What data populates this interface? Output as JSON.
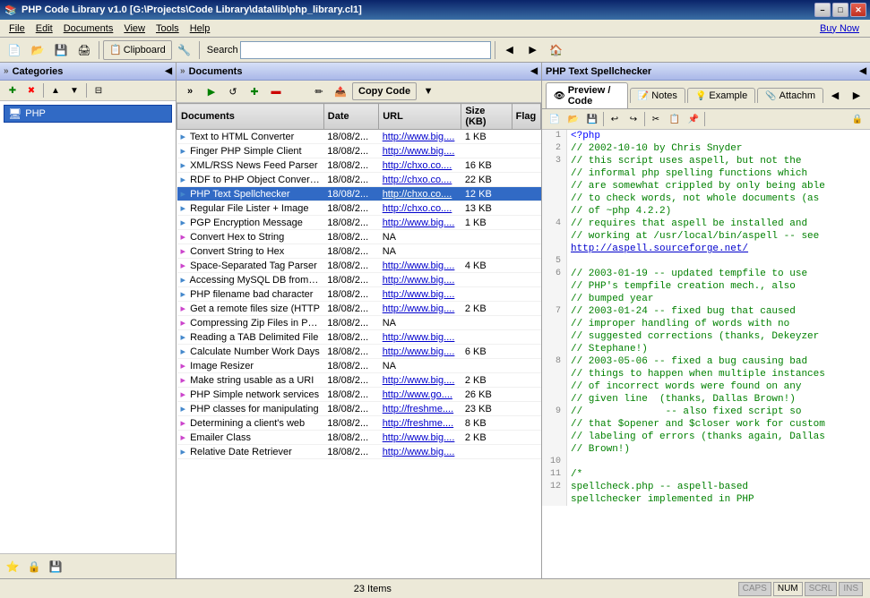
{
  "titleBar": {
    "title": "PHP Code Library v1.0 [G:\\Projects\\Code Library\\data\\lib\\php_library.cl1]",
    "icon": "📚",
    "buttons": {
      "minimize": "–",
      "maximize": "□",
      "close": "✕"
    }
  },
  "menuBar": {
    "items": [
      "File",
      "Edit",
      "Documents",
      "View",
      "Tools",
      "Help"
    ],
    "buyNow": "Buy Now"
  },
  "toolbar": {
    "clipboard": "Clipboard",
    "search": {
      "label": "Search",
      "placeholder": "Search"
    }
  },
  "categories": {
    "header": "Categories",
    "items": [
      {
        "label": "PHP",
        "icon": "🖥",
        "level": 0
      }
    ],
    "buttons": {
      "add": "+",
      "delete": "✕",
      "up": "↑",
      "down": "↓",
      "collapse": "⊟"
    },
    "bottomButtons": [
      "⭐",
      "🔒",
      "💾"
    ]
  },
  "documents": {
    "header": "Documents",
    "columns": [
      "Documents",
      "Date",
      "URL",
      "Size (KB)",
      "Flag"
    ],
    "items": [
      {
        "icon": "📄",
        "name": "Text to HTML Converter",
        "date": "18/08/2...",
        "url": "http://www.big....",
        "size": "1 KB",
        "flag": ""
      },
      {
        "icon": "📄",
        "name": "Finger PHP Simple Client",
        "date": "18/08/2...",
        "url": "http://www.big....",
        "size": "",
        "flag": ""
      },
      {
        "icon": "📄",
        "name": "XML/RSS News Feed Parser",
        "date": "18/08/2...",
        "url": "http://chxo.co....",
        "size": "16 KB",
        "flag": ""
      },
      {
        "icon": "📄",
        "name": "RDF to PHP Object Converter",
        "date": "18/08/2...",
        "url": "http://chxo.co....",
        "size": "22 KB",
        "flag": ""
      },
      {
        "icon": "📄",
        "name": "PHP Text Spellchecker",
        "date": "18/08/2...",
        "url": "http://chxo.co....",
        "size": "12 KB",
        "flag": "",
        "selected": true
      },
      {
        "icon": "📄",
        "name": "Regular File Lister + Image",
        "date": "18/08/2...",
        "url": "http://chxo.co....",
        "size": "13 KB",
        "flag": ""
      },
      {
        "icon": "📄",
        "name": "PGP Encryption Message",
        "date": "18/08/2...",
        "url": "http://www.big....",
        "size": "1 KB",
        "flag": ""
      },
      {
        "icon": "🔮",
        "name": "Convert Hex to String",
        "date": "18/08/2...",
        "url": "NA",
        "size": "",
        "flag": ""
      },
      {
        "icon": "🔮",
        "name": "Convert String to Hex",
        "date": "18/08/2...",
        "url": "NA",
        "size": "",
        "flag": ""
      },
      {
        "icon": "🔮",
        "name": "Space-Separated Tag Parser",
        "date": "18/08/2...",
        "url": "http://www.big....",
        "size": "4 KB",
        "flag": ""
      },
      {
        "icon": "📄",
        "name": "Accessing MySQL DB from P...",
        "date": "18/08/2...",
        "url": "http://www.big....",
        "size": "",
        "flag": ""
      },
      {
        "icon": "📄",
        "name": "PHP filename bad character",
        "date": "18/08/2...",
        "url": "http://www.big....",
        "size": "",
        "flag": ""
      },
      {
        "icon": "🔮",
        "name": "Get a remote files size (HTTP",
        "date": "18/08/2...",
        "url": "http://www.big....",
        "size": "2 KB",
        "flag": ""
      },
      {
        "icon": "🔮",
        "name": "Compressing Zip Files in PHP",
        "date": "18/08/2...",
        "url": "NA",
        "size": "",
        "flag": ""
      },
      {
        "icon": "📄",
        "name": "Reading a TAB Delimited File",
        "date": "18/08/2...",
        "url": "http://www.big....",
        "size": "",
        "flag": ""
      },
      {
        "icon": "📄",
        "name": "Calculate Number Work Days",
        "date": "18/08/2...",
        "url": "http://www.big....",
        "size": "6 KB",
        "flag": ""
      },
      {
        "icon": "🔮",
        "name": "Image Resizer",
        "date": "18/08/2...",
        "url": "NA",
        "size": "",
        "flag": ""
      },
      {
        "icon": "🔮",
        "name": "Make string usable as a URI",
        "date": "18/08/2...",
        "url": "http://www.big....",
        "size": "2 KB",
        "flag": ""
      },
      {
        "icon": "🔮",
        "name": "PHP Simple network services",
        "date": "18/08/2...",
        "url": "http://www.go....",
        "size": "26 KB",
        "flag": ""
      },
      {
        "icon": "📄",
        "name": "PHP classes for manipulating",
        "date": "18/08/2...",
        "url": "http://freshme....",
        "size": "23 KB",
        "flag": ""
      },
      {
        "icon": "🔮",
        "name": "Determining a client's web",
        "date": "18/08/2...",
        "url": "http://freshme....",
        "size": "8 KB",
        "flag": ""
      },
      {
        "icon": "🔮",
        "name": "Emailer Class",
        "date": "18/08/2...",
        "url": "http://www.big....",
        "size": "2 KB",
        "flag": ""
      },
      {
        "icon": "📄",
        "name": "Relative Date Retriever",
        "date": "18/08/2...",
        "url": "http://www.big....",
        "size": "",
        "flag": ""
      }
    ]
  },
  "editor": {
    "tabs": [
      {
        "label": "Preview / Code",
        "icon": "👁",
        "active": true
      },
      {
        "label": "Notes",
        "icon": "📝",
        "active": false
      },
      {
        "label": "Example",
        "icon": "💡",
        "active": false
      },
      {
        "label": "Attachm",
        "icon": "📎",
        "active": false
      }
    ],
    "code": [
      {
        "num": 1,
        "text": "<?php",
        "type": "keyword"
      },
      {
        "num": 2,
        "text": "// 2002-10-10 by Chris Snyder",
        "type": "comment"
      },
      {
        "num": 3,
        "text": "// this script uses aspell, but not the",
        "type": "comment"
      },
      {
        "num": 3,
        "text": "// informal php spelling functions which",
        "type": "comment"
      },
      {
        "num": 3,
        "text": "// are somewhat crippled by only being able",
        "type": "comment"
      },
      {
        "num": 3,
        "text": "// to check words, not whole documents (as",
        "type": "comment"
      },
      {
        "num": 3,
        "text": "// of ~php 4.2.2)",
        "type": "comment"
      },
      {
        "num": 4,
        "text": "// requires that aspell be installed and",
        "type": "comment"
      },
      {
        "num": 4,
        "text": "// working at /usr/local/bin/aspell -- see",
        "type": "comment"
      },
      {
        "num": 4,
        "text": "http://aspell.sourceforge.net/",
        "type": "link"
      },
      {
        "num": 5,
        "text": "",
        "type": "normal"
      },
      {
        "num": 6,
        "text": "// 2003-01-19 -- updated tempfile to use",
        "type": "comment"
      },
      {
        "num": 6,
        "text": "// PHP's tempfile creation mech., also",
        "type": "comment"
      },
      {
        "num": 6,
        "text": "// bumped year",
        "type": "comment"
      },
      {
        "num": 7,
        "text": "// 2003-01-24 -- fixed bug that caused",
        "type": "comment"
      },
      {
        "num": 7,
        "text": "// improper handling of words with no",
        "type": "comment"
      },
      {
        "num": 7,
        "text": "// suggested corrections (thanks, Dekeyzer",
        "type": "comment"
      },
      {
        "num": 7,
        "text": "// Stephane!)",
        "type": "comment"
      },
      {
        "num": 8,
        "text": "// 2003-05-06 -- fixed a bug causing bad",
        "type": "comment"
      },
      {
        "num": 8,
        "text": "// things to happen when multiple instances",
        "type": "comment"
      },
      {
        "num": 8,
        "text": "// of incorrect words were found on any",
        "type": "comment"
      },
      {
        "num": 8,
        "text": "// given line  (thanks, Dallas Brown!)",
        "type": "comment"
      },
      {
        "num": 9,
        "text": "//              -- also fixed script so",
        "type": "comment"
      },
      {
        "num": 9,
        "text": "// that $opener and $closer work for custom",
        "type": "comment"
      },
      {
        "num": 9,
        "text": "// labeling of errors (thanks again, Dallas",
        "type": "comment"
      },
      {
        "num": 9,
        "text": "// Brown!)",
        "type": "comment"
      },
      {
        "num": 10,
        "text": "",
        "type": "normal"
      },
      {
        "num": 11,
        "text": "/*",
        "type": "comment"
      },
      {
        "num": 12,
        "text": "// spellcheck.php -- aspell-based",
        "type": "comment"
      },
      {
        "num": 12,
        "text": "// spellchecker implemented in PHP",
        "type": "comment"
      }
    ]
  },
  "statusBar": {
    "itemCount": "23 Items",
    "indicators": [
      {
        "label": "CAPS",
        "active": false
      },
      {
        "label": "NUM",
        "active": true
      },
      {
        "label": "SCRL",
        "active": false
      },
      {
        "label": "INS",
        "active": false
      }
    ]
  }
}
